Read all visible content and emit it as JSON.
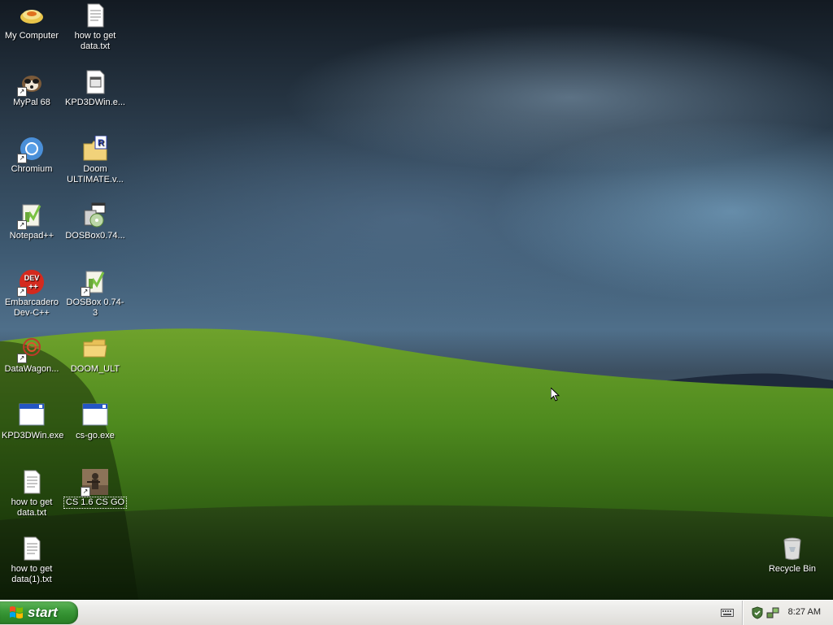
{
  "desktop_icons": [
    {
      "label": "My Computer",
      "icon": "my-computer-icon"
    },
    {
      "label": "how to get\ndata.txt",
      "icon": "text-file-icon"
    },
    {
      "label": "MyPal 68",
      "icon": "mypal-browser-icon"
    },
    {
      "label": "KPD3DWin.e...",
      "icon": "executable-file-icon"
    },
    {
      "label": "Chromium",
      "icon": "chromium-icon"
    },
    {
      "label": "Doom\nULTIMATE.v...",
      "icon": "doom-archive-icon"
    },
    {
      "label": "Notepad++",
      "icon": "notepad-plus-plus-icon"
    },
    {
      "label": "DOSBox0.74...",
      "icon": "dosbox-installer-icon"
    },
    {
      "label": "Embarcadero\nDev-C++",
      "icon": "dev-cpp-icon"
    },
    {
      "label": "DOSBox 0.74-3",
      "icon": "dosbox-icon"
    },
    {
      "label": "DataWagon...",
      "icon": "datawagon-icon"
    },
    {
      "label": "DOOM_ULT",
      "icon": "folder-icon"
    },
    {
      "label": "KPD3DWin.exe",
      "icon": "window-app-icon"
    },
    {
      "label": "cs-go.exe",
      "icon": "window-app-icon"
    },
    {
      "label": "how to get\ndata.txt",
      "icon": "text-file-icon"
    },
    {
      "label": "CS 1.6 CS GO",
      "icon": "counter-strike-icon"
    },
    {
      "label": "how to get\ndata(1).txt",
      "icon": "text-file-icon"
    },
    {
      "label": "Recycle Bin",
      "icon": "recycle-bin-icon"
    }
  ],
  "taskbar": {
    "start_label": "start",
    "clock": "8:27 AM"
  }
}
